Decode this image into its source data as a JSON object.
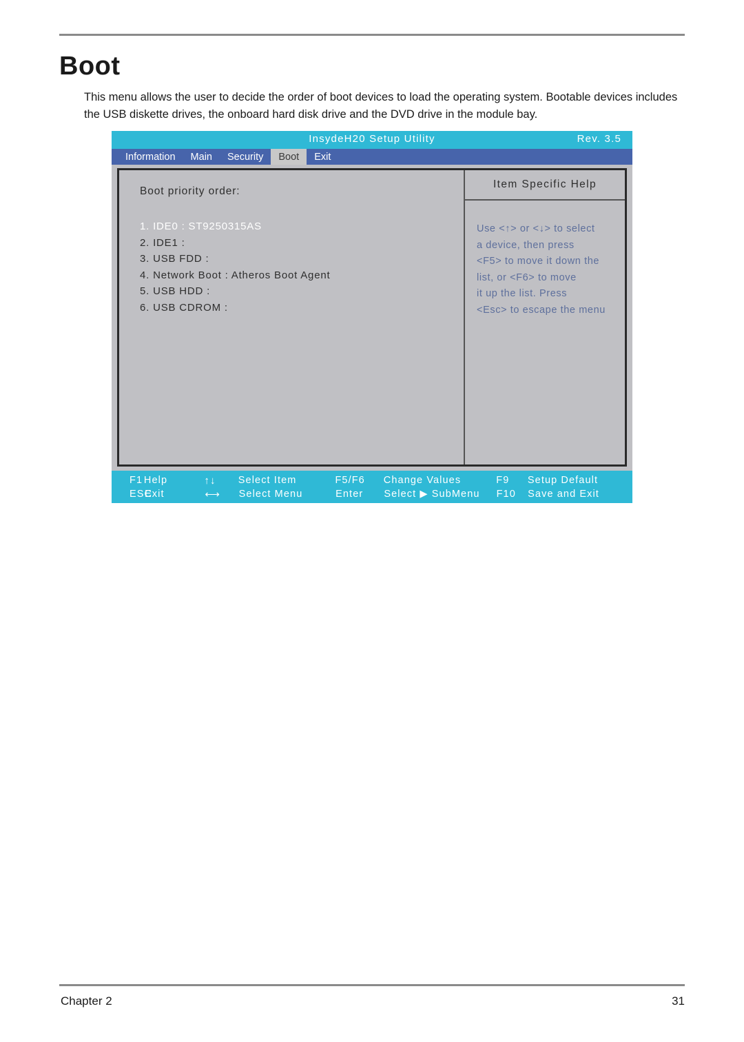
{
  "document": {
    "title": "Boot",
    "paragraph": "This menu allows the user to decide the order of boot devices to load the operating system. Bootable devices includes the USB diskette drives, the onboard hard disk drive and the DVD drive in the module bay.",
    "footer_left": "Chapter 2",
    "footer_right": "31"
  },
  "bios": {
    "title": "InsydeH20 Setup Utility",
    "revision": "Rev. 3.5",
    "menu": [
      {
        "label": "Information",
        "active": false
      },
      {
        "label": "Main",
        "active": false
      },
      {
        "label": "Security",
        "active": false
      },
      {
        "label": "Boot",
        "active": true
      },
      {
        "label": "Exit",
        "active": false
      }
    ],
    "main": {
      "section_label": "Boot priority order:",
      "items": [
        {
          "text": "1. IDE0 : ST9250315AS",
          "selected": true
        },
        {
          "text": "2. IDE1 :",
          "selected": false
        },
        {
          "text": "3. USB FDD :",
          "selected": false
        },
        {
          "text": "4. Network Boot : Atheros Boot Agent",
          "selected": false
        },
        {
          "text": "5. USB HDD :",
          "selected": false
        },
        {
          "text": "6. USB CDROM :",
          "selected": false
        }
      ]
    },
    "help": {
      "title": "Item Specific Help",
      "lines": [
        "Use <↑> or <↓> to select",
        "a device, then press",
        "<F5> to move it down the",
        "list, or <F6> to move",
        "it up the list. Press",
        "<Esc> to escape the menu"
      ]
    },
    "footer_keys": {
      "row1": {
        "key1": "F1",
        "action1": "Help",
        "symbol": "↑↓",
        "action2": "Select  Item",
        "key2": "F5/F6",
        "action3": "Change  Values",
        "key3": "F9",
        "action4": "Setup  Default"
      },
      "row2": {
        "key1": "ESC",
        "action1": "Exit",
        "symbol": "⟷",
        "action2": "Select  Menu",
        "key2": "Enter",
        "action3": "Select  ▶  SubMenu",
        "key3": "F10",
        "action4": "Save  and  Exit"
      }
    }
  },
  "colors": {
    "titlebar_cyan": "#2fb9d6",
    "menubar_blue": "#4764ab",
    "panel_gray": "#c0c0c4",
    "active_tab_gray": "#c8c8c8",
    "help_text_blue": "#5d6f9c"
  }
}
